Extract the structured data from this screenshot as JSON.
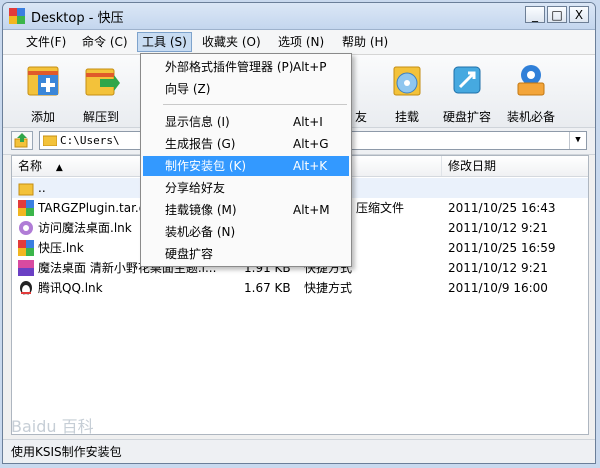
{
  "window": {
    "title": "Desktop - 快压",
    "minimize": "_",
    "maximize": "□",
    "close": "X"
  },
  "menubar": [
    {
      "label": "文件(F)"
    },
    {
      "label": "命令 (C)"
    },
    {
      "label": "工具 (S)"
    },
    {
      "label": "收藏夹 (O)"
    },
    {
      "label": "选项 (N)"
    },
    {
      "label": "帮助 (H)"
    }
  ],
  "toolbar": [
    {
      "label": "添加",
      "icon": "add-archive-icon"
    },
    {
      "label": "解压到",
      "icon": "extract-icon"
    },
    {
      "label": "友",
      "icon": "share-icon"
    },
    {
      "label": "挂载",
      "icon": "mount-disc-icon"
    },
    {
      "label": "硬盘扩容",
      "icon": "disk-expand-icon"
    },
    {
      "label": "装机必备",
      "icon": "install-essentials-icon"
    }
  ],
  "address": {
    "value": "C:\\Users\\"
  },
  "columns": {
    "name": "名称",
    "modified": "修改日期"
  },
  "files": [
    {
      "name": "..",
      "size": "",
      "type": "",
      "date": ""
    },
    {
      "name": "TARGZPlugin.tar.g",
      "size": "",
      "type": "压缩文件",
      "date": "2011/10/25 16:43"
    },
    {
      "name": "访问魔法桌面.lnk",
      "size": "",
      "type": "",
      "date": "2011/10/12 9:21"
    },
    {
      "name": "快压.lnk",
      "size": "",
      "type": "",
      "date": "2011/10/25 16:59"
    },
    {
      "name": "魔法桌面 清新小野花桌面主题.l...",
      "size": "1.91 KB",
      "type": "快捷方式",
      "date": "2011/10/12 9:21"
    },
    {
      "name": "腾讯QQ.lnk",
      "size": "1.67 KB",
      "type": "快捷方式",
      "date": "2011/10/9 16:00"
    }
  ],
  "tools_menu": [
    {
      "label": "外部格式插件管理器 (P)",
      "shortcut": "Alt+P"
    },
    {
      "label": "向导 (Z)",
      "shortcut": ""
    },
    {
      "label": "显示信息 (I)",
      "shortcut": "Alt+I"
    },
    {
      "label": "生成报告 (G)",
      "shortcut": "Alt+G"
    },
    {
      "label": "制作安装包 (K)",
      "shortcut": "Alt+K"
    },
    {
      "label": "分享给好友",
      "shortcut": ""
    },
    {
      "label": "挂载镜像 (M)",
      "shortcut": "Alt+M"
    },
    {
      "label": "装机必备 (N)",
      "shortcut": ""
    },
    {
      "label": "硬盘扩容",
      "shortcut": ""
    }
  ],
  "status": "使用KSIS制作安装包",
  "watermark": "Baidu 百科",
  "colors": {
    "accent": "#3399ff",
    "titlebar": "#c4d6ee"
  }
}
